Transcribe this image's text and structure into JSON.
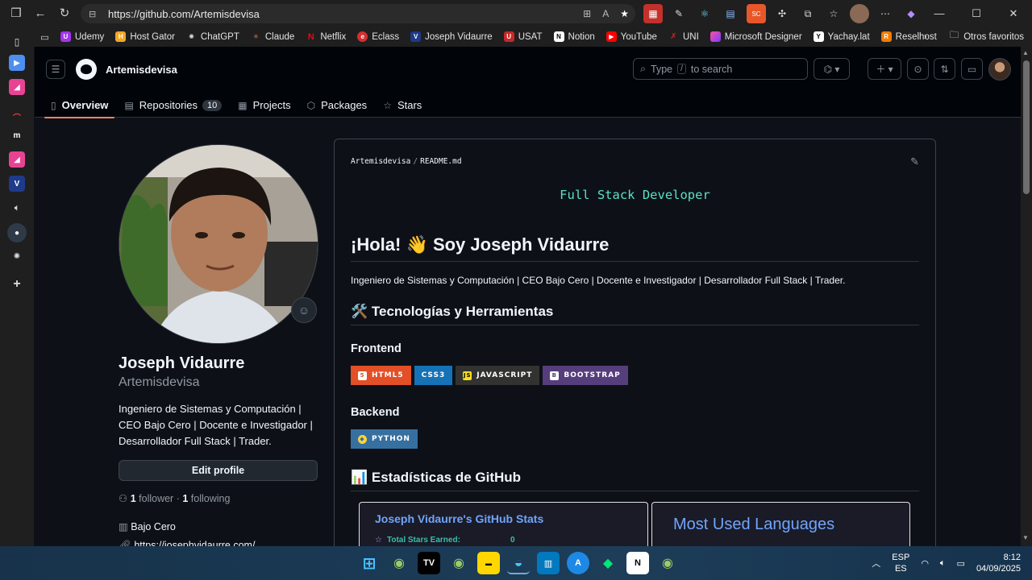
{
  "browser": {
    "url": "https://github.com/Artemisdevisa",
    "bookmarks": [
      "Udemy",
      "Host Gator",
      "ChatGPT",
      "Claude",
      "Netflix",
      "Eclass",
      "Joseph Vidaurre",
      "USAT",
      "Notion",
      "YouTube",
      "UNI",
      "Microsoft Designer",
      "Yachay.lat",
      "Reselhost"
    ],
    "other_favorites": "Otros favoritos"
  },
  "github": {
    "username": "Artemisdevisa",
    "search_placeholder": "Type [/] to search",
    "search_pre": "Type",
    "search_key": "/",
    "search_post": "to search",
    "tabs": [
      {
        "label": "Overview",
        "icon": "book-icon"
      },
      {
        "label": "Repositories",
        "icon": "repo-icon",
        "count": "10"
      },
      {
        "label": "Projects",
        "icon": "table-icon"
      },
      {
        "label": "Packages",
        "icon": "package-icon"
      },
      {
        "label": "Stars",
        "icon": "star-icon"
      }
    ]
  },
  "profile": {
    "name": "Joseph Vidaurre",
    "login": "Artemisdevisa",
    "bio": "Ingeniero de Sistemas y Computación | CEO Bajo Cero | Docente e Investigador | Desarrollador Full Stack | Trader.",
    "edit_label": "Edit profile",
    "followers": "1",
    "followers_label": "follower",
    "following": "1",
    "following_label": "following",
    "company": "Bajo Cero",
    "website": "https://josephvidaurre.com/"
  },
  "readme": {
    "repo": "Artemisdevisa",
    "file": "README.md",
    "typing_text": "Full Stack Developer",
    "greeting": "¡Hola! 👋 Soy Joseph Vidaurre",
    "intro": "Ingeniero de Sistemas y Computación | CEO Bajo Cero | Docente e Investigador | Desarrollador Full Stack | Trader.",
    "tech_heading": "🛠️ Tecnologías y Herramientas",
    "frontend_heading": "Frontend",
    "frontend_badges": [
      {
        "label": "HTML5",
        "color": "#e34f26"
      },
      {
        "label": "CSS3",
        "color": "#1572b6"
      },
      {
        "label": "JAVASCRIPT",
        "color": "#323330"
      },
      {
        "label": "BOOTSTRAP",
        "color": "#563d7c"
      }
    ],
    "backend_heading": "Backend",
    "backend_badges": [
      {
        "label": "PYTHON",
        "color": "#3670a0"
      }
    ],
    "stats_heading": "📊 Estadísticas de GitHub",
    "stats_card_title": "Joseph Vidaurre's GitHub Stats",
    "stats_row_label": "Total Stars Earned:",
    "stats_row_value": "0",
    "languages_card_title": "Most Used Languages"
  },
  "taskbar": {
    "lang": "ESP",
    "lang2": "ES",
    "time": "8:12",
    "date": "04/09/2025"
  }
}
